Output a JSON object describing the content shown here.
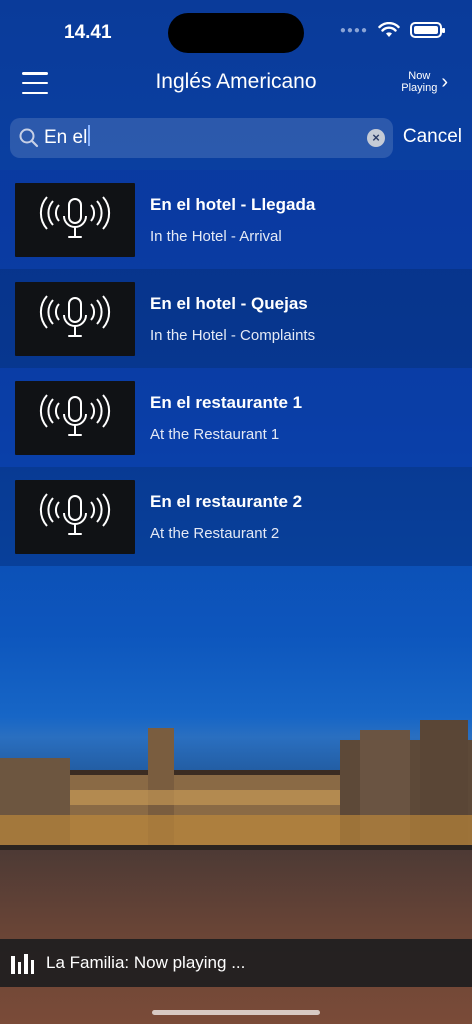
{
  "status": {
    "time": "14.41"
  },
  "nav": {
    "title": "Inglés Americano",
    "now_playing_line1": "Now",
    "now_playing_line2": "Playing"
  },
  "search": {
    "value": "En el",
    "cancel_label": "Cancel"
  },
  "results": [
    {
      "title": "En el hotel - Llegada",
      "subtitle": "In the Hotel - Arrival"
    },
    {
      "title": "En el hotel - Quejas",
      "subtitle": "In the Hotel - Complaints"
    },
    {
      "title": "En el restaurante 1",
      "subtitle": "At the Restaurant 1"
    },
    {
      "title": "En el restaurante 2",
      "subtitle": "At the Restaurant 2"
    }
  ],
  "player": {
    "label": "La Familia: Now playing ..."
  },
  "icons": {
    "menu": "hamburger-menu-icon",
    "search": "search-icon",
    "clear": "clear-x-icon",
    "thumb": "microphone-broadcast-icon",
    "player": "equalizer-bars-icon"
  },
  "colors": {
    "background": "#0b3a93",
    "thumb": "#101215",
    "player_bar": "#1e1e20"
  }
}
